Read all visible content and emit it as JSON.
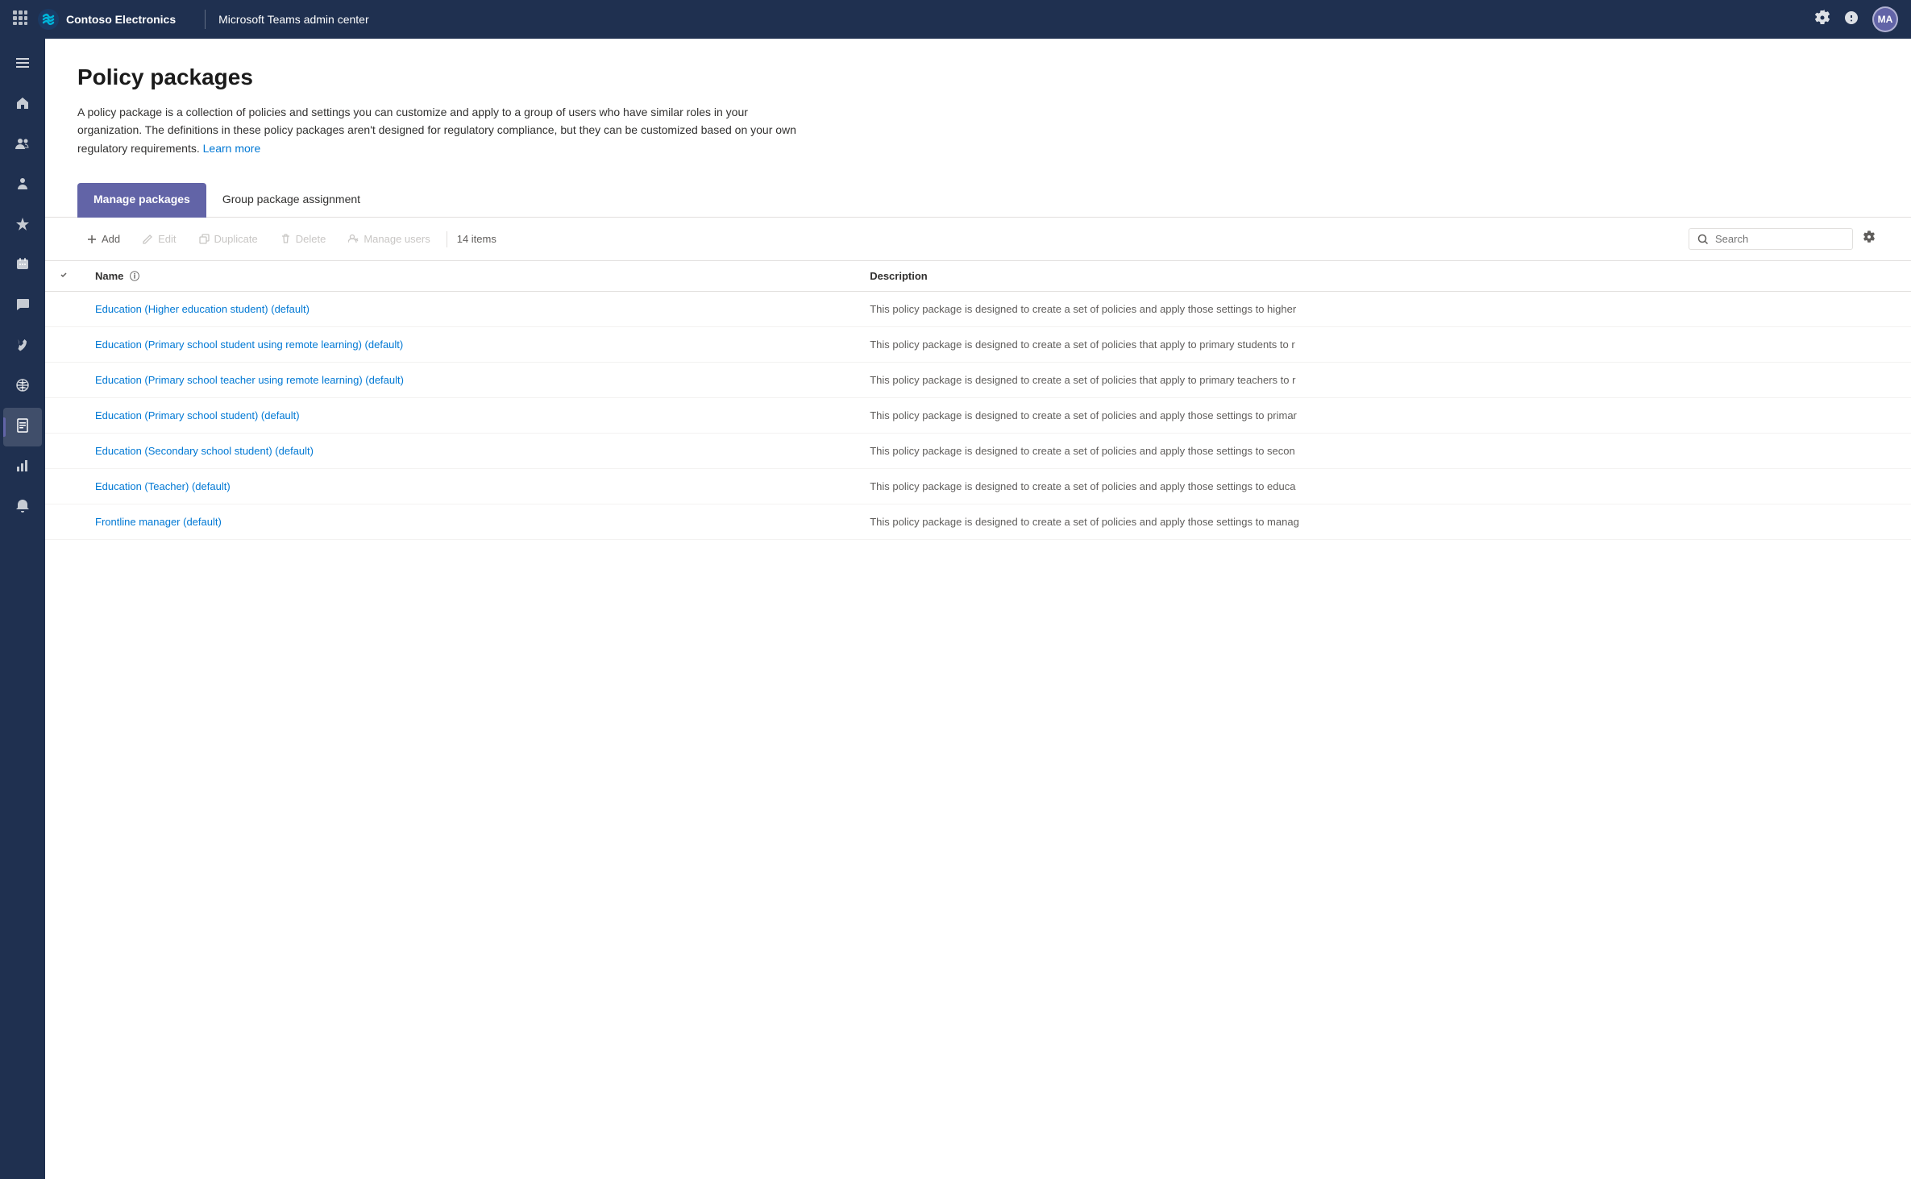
{
  "topbar": {
    "brand": "Contoso Electronics",
    "title": "Microsoft Teams admin center",
    "avatar_initials": "MA",
    "grid_icon": "⊞"
  },
  "sidebar": {
    "items": [
      {
        "id": "menu",
        "icon": "☰",
        "label": "Menu",
        "active": false
      },
      {
        "id": "home",
        "icon": "⌂",
        "label": "Home",
        "active": false
      },
      {
        "id": "users",
        "icon": "👥",
        "label": "Users",
        "active": false
      },
      {
        "id": "teams",
        "icon": "👤",
        "label": "Teams",
        "active": false
      },
      {
        "id": "apps",
        "icon": "🚀",
        "label": "Apps",
        "active": false
      },
      {
        "id": "meetings",
        "icon": "📦",
        "label": "Meetings",
        "active": false
      },
      {
        "id": "calendar",
        "icon": "📅",
        "label": "Calendar",
        "active": false
      },
      {
        "id": "messaging",
        "icon": "💬",
        "label": "Messaging",
        "active": false
      },
      {
        "id": "voice",
        "icon": "📞",
        "label": "Voice",
        "active": false
      },
      {
        "id": "locations",
        "icon": "🌐",
        "label": "Locations",
        "active": false
      },
      {
        "id": "policy",
        "icon": "📋",
        "label": "Policy packages",
        "active": true
      },
      {
        "id": "analytics",
        "icon": "📊",
        "label": "Analytics",
        "active": false
      },
      {
        "id": "notifications",
        "icon": "🔔",
        "label": "Notifications",
        "active": false
      }
    ]
  },
  "page": {
    "title": "Policy packages",
    "description": "A policy package is a collection of policies and settings you can customize and apply to a group of users who have similar roles in your organization. The definitions in these policy packages aren't designed for regulatory compliance, but they can be customized based on your own regulatory requirements.",
    "learn_more_text": "Learn more"
  },
  "tabs": [
    {
      "id": "manage",
      "label": "Manage packages",
      "active": true
    },
    {
      "id": "group",
      "label": "Group package assignment",
      "active": false
    }
  ],
  "toolbar": {
    "add_label": "Add",
    "edit_label": "Edit",
    "duplicate_label": "Duplicate",
    "delete_label": "Delete",
    "manage_users_label": "Manage users",
    "items_count": "14 items",
    "search_placeholder": "Search"
  },
  "table": {
    "columns": [
      {
        "id": "name",
        "label": "Name"
      },
      {
        "id": "description",
        "label": "Description"
      }
    ],
    "rows": [
      {
        "name": "Education (Higher education student) (default)",
        "description": "This policy package is designed to create a set of policies and apply those settings to higher"
      },
      {
        "name": "Education (Primary school student using remote learning) (default)",
        "description": "This policy package is designed to create a set of policies that apply to primary students to r"
      },
      {
        "name": "Education (Primary school teacher using remote learning) (default)",
        "description": "This policy package is designed to create a set of policies that apply to primary teachers to r"
      },
      {
        "name": "Education (Primary school student) (default)",
        "description": "This policy package is designed to create a set of policies and apply those settings to primar"
      },
      {
        "name": "Education (Secondary school student) (default)",
        "description": "This policy package is designed to create a set of policies and apply those settings to secon"
      },
      {
        "name": "Education (Teacher) (default)",
        "description": "This policy package is designed to create a set of policies and apply those settings to educa"
      },
      {
        "name": "Frontline manager (default)",
        "description": "This policy package is designed to create a set of policies and apply those settings to manag"
      }
    ]
  }
}
